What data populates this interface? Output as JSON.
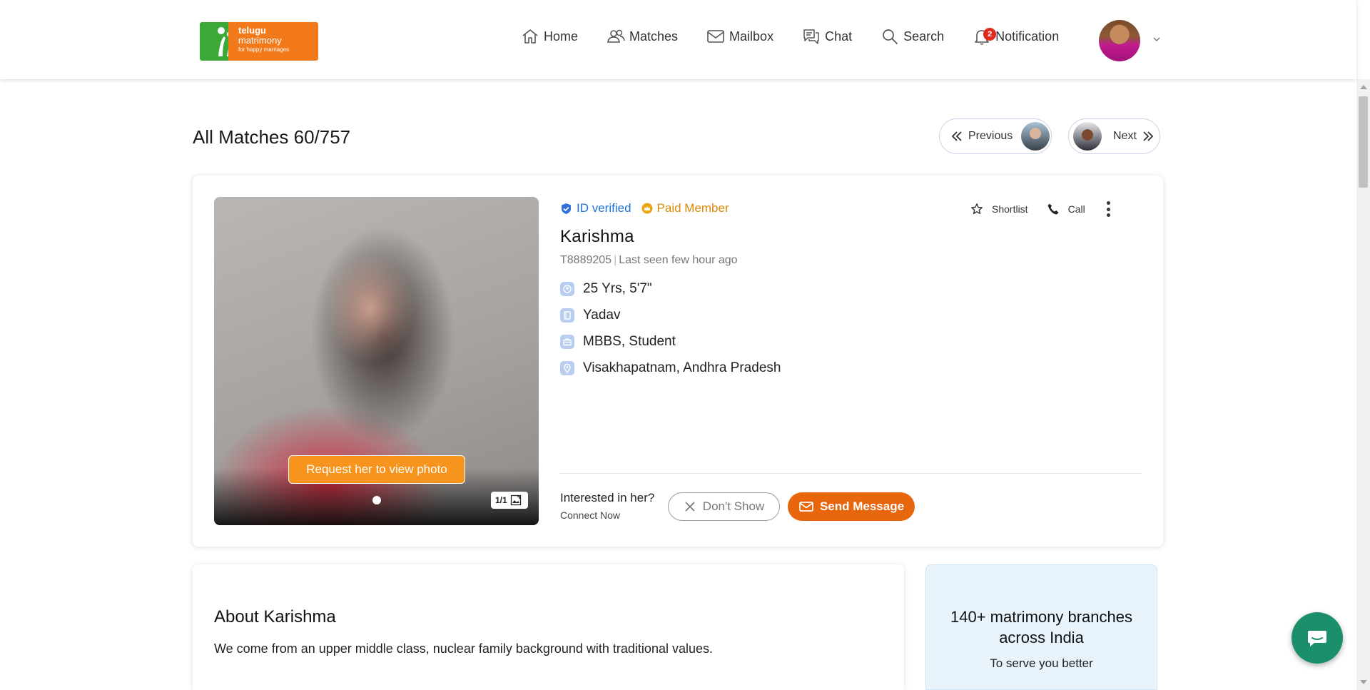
{
  "logo": {
    "line1": "telugu",
    "line2": "matrimony",
    "line3": "for happy marriages"
  },
  "nav": {
    "home": "Home",
    "matches": "Matches",
    "mailbox": "Mailbox",
    "chat": "Chat",
    "search": "Search",
    "notification": "Notification",
    "notification_count": "2"
  },
  "page": {
    "title": "All Matches 60/757",
    "previous": "Previous",
    "next": "Next"
  },
  "profile": {
    "id_verified": "ID verified",
    "paid_member": "Paid Member",
    "name": "Karishma",
    "profile_id": "T8889205",
    "last_seen": "Last seen few hour ago",
    "age_height": "25 Yrs, 5'7\"",
    "caste": "Yadav",
    "education": "MBBS, Student",
    "location": "Visakhapatnam, Andhra Pradesh",
    "request_photo": "Request her to view photo",
    "photo_counter": "1/1",
    "shortlist": "Shortlist",
    "call": "Call",
    "interested": "Interested in her?",
    "connect_now": "Connect Now",
    "dont_show": "Don't Show",
    "send_message": "Send Message"
  },
  "about": {
    "title": "About Karishma",
    "text": "We come from an upper middle class, nuclear family background with traditional values."
  },
  "branches": {
    "title": "140+ matrimony branches across India",
    "subtitle": "To serve you better"
  },
  "colors": {
    "brand_orange": "#e8660c",
    "request_orange": "#f7941d",
    "verified_blue": "#1d72d8",
    "paid_gold": "#d68a06",
    "chat_fab": "#1b8f6c"
  },
  "icons": [
    "home-icon",
    "matches-icon",
    "mailbox-icon",
    "chat-icon",
    "search-icon",
    "bell-icon",
    "chevron-down-icon",
    "double-chevron-left-icon",
    "double-chevron-right-icon",
    "verified-icon",
    "crown-icon",
    "star-icon",
    "phone-icon",
    "more-icon",
    "close-icon",
    "mail-icon",
    "chat-bubble-icon"
  ]
}
